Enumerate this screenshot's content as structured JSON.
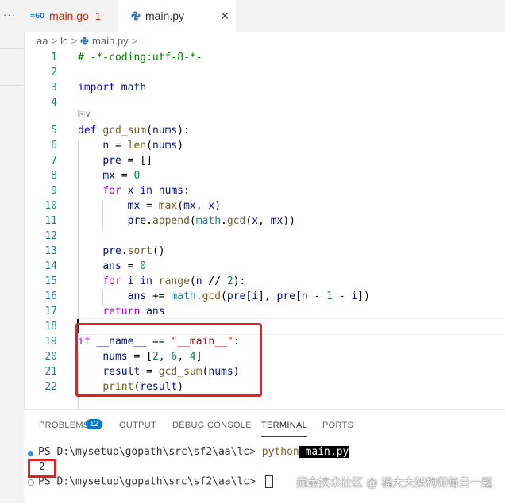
{
  "tabs": [
    {
      "label": "main.go",
      "badge": "1",
      "icon": "go-file-icon"
    },
    {
      "label": "main.py",
      "icon": "python-file-icon",
      "close": "✕"
    }
  ],
  "breadcrumb": [
    "aa",
    "lc",
    "main.py",
    "..."
  ],
  "editor": {
    "codelens": "⎘∨",
    "lines": [
      {
        "n": "1",
        "text": "# -*-coding:utf-8-*-"
      },
      {
        "n": "2",
        "text": ""
      },
      {
        "n": "3",
        "text": "import math"
      },
      {
        "n": "4",
        "text": ""
      },
      {
        "n": "5",
        "text": "def gcd_sum(nums):"
      },
      {
        "n": "6",
        "text": "    n = len(nums)"
      },
      {
        "n": "7",
        "text": "    pre = []"
      },
      {
        "n": "8",
        "text": "    mx = 0"
      },
      {
        "n": "9",
        "text": "    for x in nums:"
      },
      {
        "n": "10",
        "text": "        mx = max(mx, x)"
      },
      {
        "n": "11",
        "text": "        pre.append(math.gcd(x, mx))"
      },
      {
        "n": "12",
        "text": ""
      },
      {
        "n": "13",
        "text": "    pre.sort()"
      },
      {
        "n": "14",
        "text": "    ans = 0"
      },
      {
        "n": "15",
        "text": "    for i in range(n // 2):"
      },
      {
        "n": "16",
        "text": "        ans += math.gcd(pre[i], pre[n - 1 - i])"
      },
      {
        "n": "17",
        "text": "    return ans"
      },
      {
        "n": "18",
        "text": ""
      },
      {
        "n": "19",
        "text": "if __name__ == \"__main__\":"
      },
      {
        "n": "20",
        "text": "    nums = [2, 6, 4]"
      },
      {
        "n": "21",
        "text": "    result = gcd_sum(nums)"
      },
      {
        "n": "22",
        "text": "    print(result)"
      }
    ]
  },
  "panel": {
    "tabs": [
      "PROBLEMS",
      "OUTPUT",
      "DEBUG CONSOLE",
      "TERMINAL",
      "PORTS"
    ],
    "problems_count": "12",
    "active_tab": "TERMINAL"
  },
  "terminal": {
    "prompt1": "PS D:\\mysetup\\gopath\\src\\sf2\\aa\\lc> ",
    "cmd": "python",
    "arg": " main.py",
    "output": "2",
    "prompt2": "PS D:\\mysetup\\gopath\\src\\sf2\\aa\\lc> "
  },
  "watermark": "掘金技术社区 @ 福大大架构师每日一题",
  "colors": {
    "keyword": "#0000ff",
    "control": "#af00db",
    "function": "#795e26",
    "string": "#a31515",
    "number": "#098658",
    "comment": "#008000",
    "highlight_box": "#e32222",
    "badge": "#007acc"
  }
}
